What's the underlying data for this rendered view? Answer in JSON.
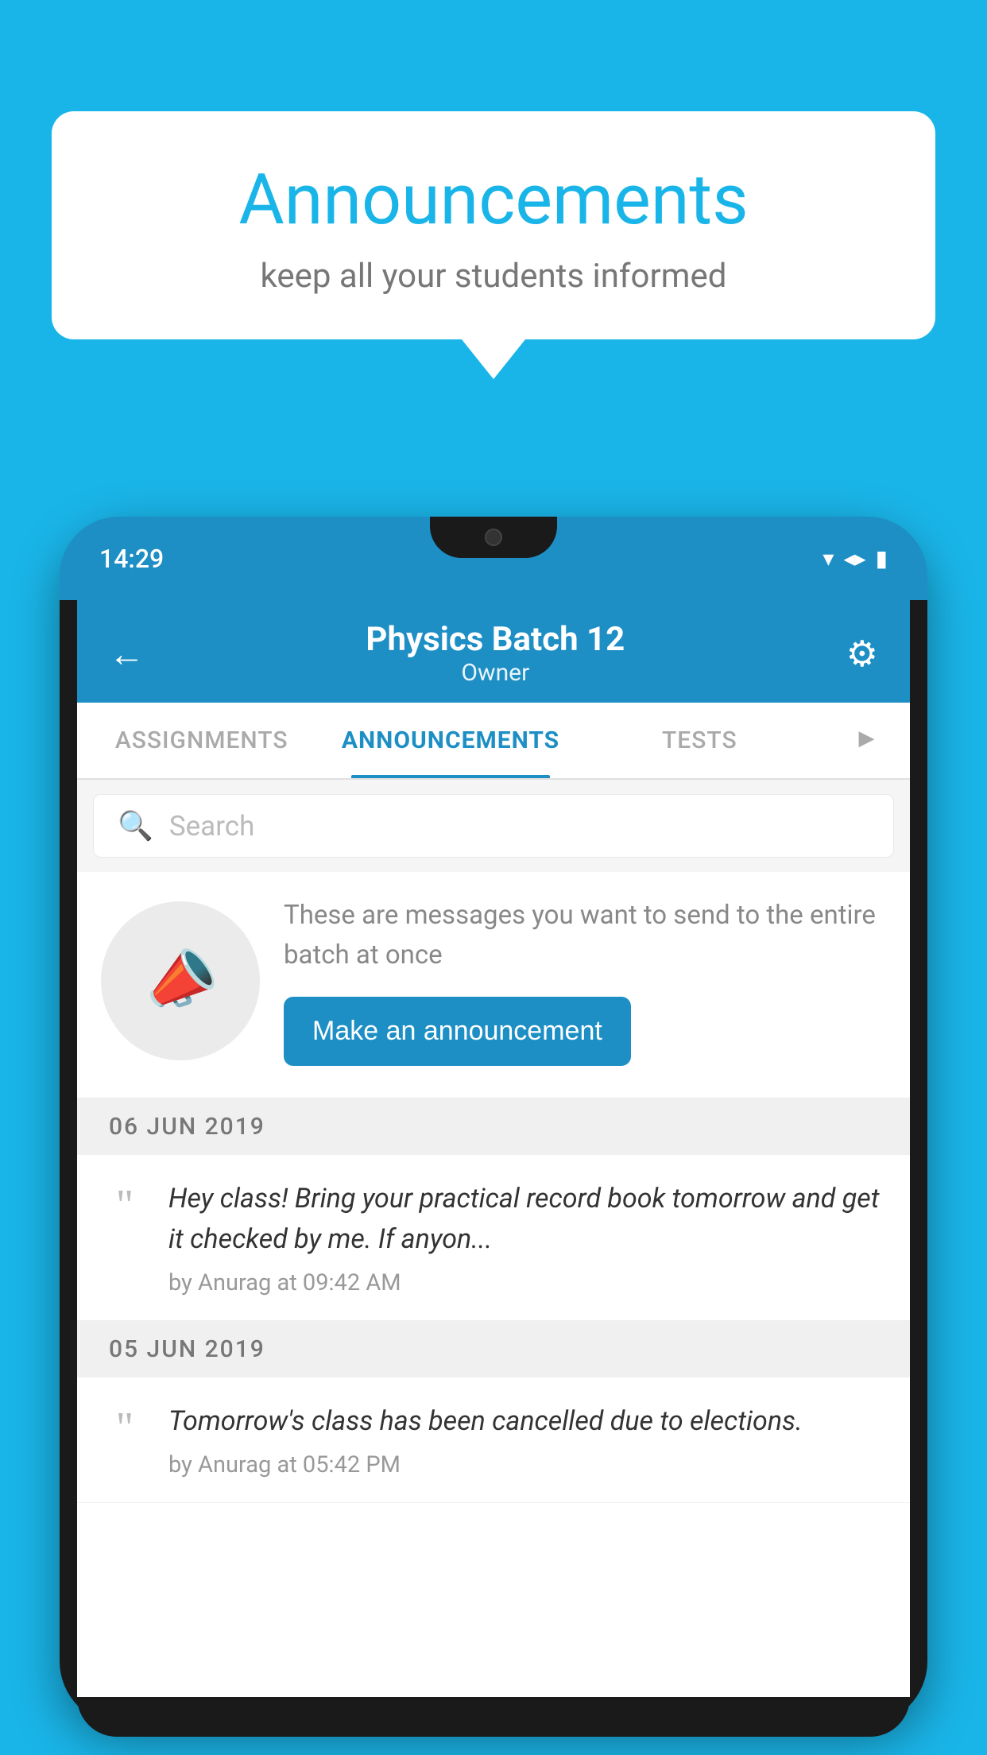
{
  "background_color": "#1ab5e8",
  "speech_bubble": {
    "title": "Announcements",
    "subtitle": "keep all your students informed"
  },
  "phone": {
    "status_bar": {
      "time": "14:29",
      "wifi": "▼",
      "signal": "▲",
      "battery": "▮"
    },
    "header": {
      "back_label": "←",
      "title": "Physics Batch 12",
      "subtitle": "Owner",
      "gear_label": "⚙"
    },
    "tabs": [
      {
        "label": "ASSIGNMENTS",
        "active": false
      },
      {
        "label": "ANNOUNCEMENTS",
        "active": true
      },
      {
        "label": "TESTS",
        "active": false
      },
      {
        "label": "•••",
        "active": false
      }
    ],
    "search": {
      "placeholder": "Search"
    },
    "promo": {
      "description": "These are messages you want to send to the entire batch at once",
      "button_label": "Make an announcement"
    },
    "announcements": [
      {
        "date": "06  JUN  2019",
        "text": "Hey class! Bring your practical record book tomorrow and get it checked by me. If anyon...",
        "meta": "by Anurag at 09:42 AM"
      },
      {
        "date": "05  JUN  2019",
        "text": "Tomorrow's class has been cancelled due to elections.",
        "meta": "by Anurag at 05:42 PM"
      }
    ]
  }
}
